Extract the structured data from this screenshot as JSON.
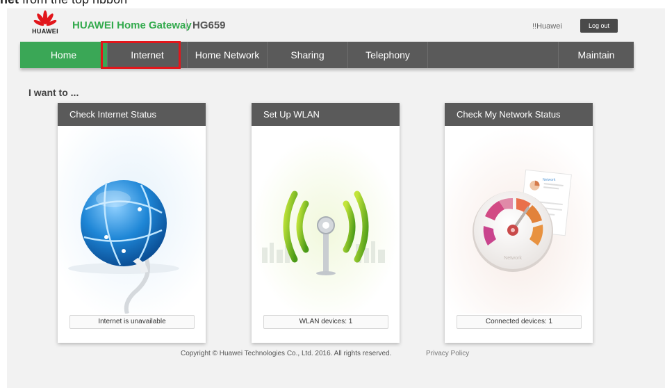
{
  "caption": {
    "bold": "net",
    "rest": " from the top ribbon"
  },
  "header": {
    "logo_text": "HUAWEI",
    "brand": "HUAWEI Home Gateway",
    "model": "HG659",
    "user": "!!Huawei",
    "logout": "Log out"
  },
  "nav": {
    "items": [
      {
        "label": "Home",
        "active": true
      },
      {
        "label": "Internet",
        "highlighted": true
      },
      {
        "label": "Home Network"
      },
      {
        "label": "Sharing"
      },
      {
        "label": "Telephony"
      },
      {
        "label": ""
      },
      {
        "label": "Maintain"
      }
    ]
  },
  "main": {
    "heading": "I want to ...",
    "cards": [
      {
        "title": "Check Internet Status",
        "status": "Internet is unavailable",
        "icon": "globe-icon"
      },
      {
        "title": "Set Up WLAN",
        "status": "WLAN devices: 1",
        "icon": "wifi-antenna-icon"
      },
      {
        "title": "Check My Network Status",
        "status": "Connected devices: 1",
        "icon": "network-gauge-icon",
        "gauge_label": "Network",
        "doc_label": "Network"
      }
    ]
  },
  "footer": {
    "copyright": "Copyright © Huawei Technologies Co., Ltd. 2016. All rights reserved.",
    "privacy": "Privacy Policy"
  },
  "colors": {
    "accent_green": "#3aa756",
    "nav_gray": "#5a5a5a",
    "highlight_red": "#e2161b",
    "brand_green": "#33aa4d"
  }
}
